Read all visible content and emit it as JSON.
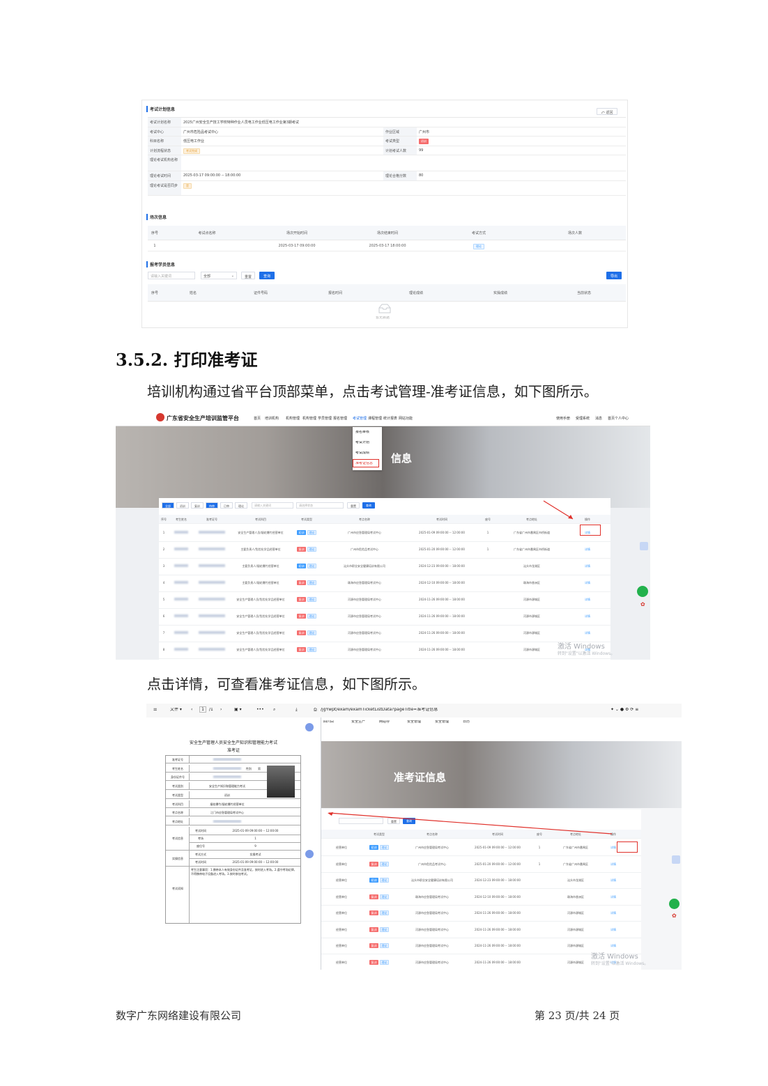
{
  "screenshot1": {
    "plan_section": "考试计划信息",
    "back_button": "返回",
    "plan_rows": [
      {
        "k": "考试计划名称",
        "v": "2025广州安全生产技工学校特种作业人员电工作业低压电工作业第3期考试"
      },
      {
        "k": "考试中心",
        "v": "广州市危险品考试中心",
        "k2": "作业区域",
        "v2": "广州市"
      },
      {
        "k": "科目名称",
        "v": "低压电工作业",
        "k2": "考试类型",
        "v2": "初训"
      },
      {
        "k": "计划流程状态",
        "v": "考试完成",
        "k2": "计划考试人数",
        "v2": "99"
      },
      {
        "k": "理论考试机构名称",
        "v": ""
      },
      {
        "k": "理论考试时间",
        "v": "2025-03-17 09:00:00 -- 18:00:00",
        "k2": "理论合格分数",
        "v2": "80"
      },
      {
        "k": "理论考试是否同步",
        "v": "是"
      }
    ],
    "session_section": "场次信息",
    "session_headers": [
      "序号",
      "考试点名称",
      "场次开始时间",
      "场次结束时间",
      "考试方式",
      "场次人数"
    ],
    "session_rows": [
      [
        "1",
        "",
        "2025-03-17 09:00:00",
        "2025-03-17 18:00:00",
        "理论",
        ""
      ]
    ],
    "student_section": "报考学员信息",
    "search_placeholder": "请输入关键词",
    "select_value": "全部",
    "reset_label": "重置",
    "query_label": "查询",
    "export_label": "导出",
    "student_headers": [
      "序号",
      "姓名",
      "证件号码",
      "报名时间",
      "理论成绩",
      "实操成绩",
      "当前状态"
    ],
    "empty_text": "暂无数据"
  },
  "section_heading": {
    "number": "3.5.2.",
    "title": "打印准考证"
  },
  "para1": "培训机构通过省平台顶部菜单，点击考试管理-准考证信息，如下图所示。",
  "screenshot2": {
    "site_title": "广东省安全生产培训监管平台",
    "nav_items": [
      "首页",
      "培训机构",
      "机构管理",
      "机构管理",
      "学员管理",
      "报名管理",
      "考试管理",
      "课程管理",
      "统计报表",
      "网站功能"
    ],
    "user_items": [
      "使用手册",
      "受理系统",
      "消息",
      "首页个人中心"
    ],
    "dropdown_items": [
      "报名审核",
      "考试计划",
      "考试成绩",
      "准考证信息"
    ],
    "banner_title": "信息",
    "filter_buttons": [
      "全部",
      "初训",
      "复训",
      "待审",
      "已审",
      "理论"
    ],
    "filter_placeholder1": "请输入关键词",
    "filter_placeholder2": "请选择状态",
    "reset_label": "重置",
    "query_label": "查询",
    "table_headers": [
      "序号",
      "考生姓名",
      "准考证号",
      "考试科目",
      "考试类型",
      "考点名称",
      "考试时间",
      "座号",
      "考点地址",
      "操作"
    ],
    "rows": [
      {
        "n": "1",
        "subject": "安全生产管理人员/烟花爆竹经营单位",
        "t1": "初训",
        "t2": "理论",
        "site": "广州市应急管理局考试中心",
        "time": "2025-01-09 09:00:00 -- 12:00:00",
        "seat": "1",
        "addr": "广东省广州市番禺区市桥街道",
        "op": "详情"
      },
      {
        "n": "2",
        "subject": "主要负责人/危险化学品经营单位",
        "t1": "复训",
        "t2": "理论",
        "site": "广州市危险品考试中心",
        "time": "2025-01-20 09:00:00 -- 12:00:00",
        "seat": "1",
        "addr": "广东省广州市番禺区市桥街道",
        "op": "详情"
      },
      {
        "n": "3",
        "subject": "主要负责人/烟花爆竹经营单位",
        "t1": "初训",
        "t2": "理论",
        "site": "汕头市职业安全健康培训有限公司",
        "time": "2024-12-23 09:00:00 -- 18:00:00",
        "seat": "",
        "addr": "汕头市龙湖区",
        "op": "详情"
      },
      {
        "n": "4",
        "subject": "主要负责人/烟花爆竹经营单位",
        "t1": "复训",
        "t2": "理论",
        "site": "珠海市应急管理局考试中心",
        "time": "2024-12-10 09:00:00 -- 18:00:00",
        "seat": "",
        "addr": "珠海市香洲区",
        "op": "详情"
      },
      {
        "n": "5",
        "subject": "安全生产管理人员/危险化学品经营单位",
        "t1": "复训",
        "t2": "理论",
        "site": "河源市应急管理局考试中心",
        "time": "2024-11-26 09:00:00 -- 18:00:00",
        "seat": "",
        "addr": "河源市源城区",
        "op": "详情"
      },
      {
        "n": "6",
        "subject": "安全生产管理人员/危险化学品经营单位",
        "t1": "复训",
        "t2": "理论",
        "site": "河源市应急管理局考试中心",
        "time": "2024-11-26 09:00:00 -- 18:00:00",
        "seat": "",
        "addr": "河源市源城区",
        "op": "详情"
      },
      {
        "n": "7",
        "subject": "安全生产管理人员/危险化学品经营单位",
        "t1": "复训",
        "t2": "理论",
        "site": "河源市应急管理局考试中心",
        "time": "2024-11-26 09:00:00 -- 18:00:00",
        "seat": "",
        "addr": "河源市源城区",
        "op": "详情"
      },
      {
        "n": "8",
        "subject": "安全生产管理人员/危险化学品经营单位",
        "t1": "复训",
        "t2": "理论",
        "site": "河源市应急管理局考试中心",
        "time": "2024-11-26 09:00:00 -- 18:00:00",
        "seat": "",
        "addr": "河源市源城区",
        "op": "详情"
      }
    ],
    "watermark": "激活 Windows",
    "watermark_sub": "转到\"设置\"以激活 Windows。"
  },
  "para2": "点击详情，可查看准考证信息，如下图所示。",
  "screenshot3": {
    "pdf_file_label": "文件",
    "pdf_page": "1",
    "pdf_page_total": "/1",
    "pdf_url": "/jgYwpt/exam/examTicketListData?pageTitle=准考证信息",
    "bookmarks": [
      "四川白",
      "安全生产",
      "网站导",
      "安全管理",
      "安全管理",
      "日历"
    ],
    "ticket_title": "安全生产管理人员安全生产知识和管理能力考试",
    "ticket_subtitle": "准考证",
    "ticket_rows": [
      {
        "k": "准考证号",
        "v": ""
      },
      {
        "k": "考生姓名",
        "v": "",
        "extra": "性别",
        "extra2": "男"
      },
      {
        "k": "身份证件号",
        "v": ""
      },
      {
        "k": "考试类别",
        "v": "安全生产知识和管理能力考试"
      },
      {
        "k": "考试类型",
        "v": "初训"
      },
      {
        "k": "考试科目",
        "v": "烟花爆竹/烟花爆竹经营单位"
      },
      {
        "k": "考点名称",
        "v": "江门市应急管理局考试中心"
      },
      {
        "k": "考点地址",
        "v": ""
      }
    ],
    "theory_label": "考试信息",
    "theory_rows": [
      {
        "k": "考试时间",
        "v": "2025-01-09 09:00:00 -- 12:00:00"
      },
      {
        "k": "考场",
        "v": "1"
      },
      {
        "k": "座位号",
        "v": "9"
      }
    ],
    "practice_label": "实操信息",
    "practice_rows": [
      {
        "k": "考试方式",
        "v": "实操考试"
      },
      {
        "k": "考试时间",
        "v": "2025-01-09 09:00:00 -- 12:00:00"
      }
    ],
    "notice_label": "考试须知",
    "notice_text": "考生注意事项：1.携带本人有效身份证件及准考证，按时进入考场。2.遵守考场纪律，不得携带电子设备进入考场。3.按时参加考试。",
    "banner_title": "准考证信息",
    "reset_label": "重置",
    "query_label": "查询",
    "table_headers": [
      "考试类型",
      "考点名称",
      "考试时间",
      "座号",
      "考点地址",
      "操作"
    ],
    "rows": [
      {
        "c": "经营单位",
        "t1": "初训",
        "t2": "理论",
        "site": "广州市应急管理局考试中心",
        "time": "2025-01-09 09:00:00 -- 12:00:00",
        "seat": "1",
        "addr": "广东省广州市番禺区",
        "op": "详情"
      },
      {
        "c": "经营单位",
        "t1": "复训",
        "t2": "理论",
        "site": "广州市危险品考试中心",
        "time": "2025-01-20 09:00:00 -- 12:00:00",
        "seat": "1",
        "addr": "广东省广州市番禺区",
        "op": "详情"
      },
      {
        "c": "经营单位",
        "t1": "初训",
        "t2": "理论",
        "site": "汕头市职业安全健康培训有限公司",
        "time": "2024-12-23 09:00:00 -- 18:00:00",
        "seat": "",
        "addr": "汕头市龙湖区",
        "op": "详情"
      },
      {
        "c": "经营单位",
        "t1": "复训",
        "t2": "理论",
        "site": "珠海市应急管理局考试中心",
        "time": "2024-12-10 09:00:00 -- 18:00:00",
        "seat": "",
        "addr": "珠海市香洲区",
        "op": "详情"
      },
      {
        "c": "经营单位",
        "t1": "复训",
        "t2": "理论",
        "site": "河源市应急管理局考试中心",
        "time": "2024-11-26 09:00:00 -- 18:00:00",
        "seat": "",
        "addr": "河源市源城区",
        "op": "详情"
      },
      {
        "c": "经营单位",
        "t1": "复训",
        "t2": "理论",
        "site": "河源市应急管理局考试中心",
        "time": "2024-11-26 09:00:00 -- 18:00:00",
        "seat": "",
        "addr": "河源市源城区",
        "op": "详情"
      },
      {
        "c": "经营单位",
        "t1": "复训",
        "t2": "理论",
        "site": "河源市应急管理局考试中心",
        "time": "2024-11-26 09:00:00 -- 18:00:00",
        "seat": "",
        "addr": "河源市源城区",
        "op": "详情"
      },
      {
        "c": "经营单位",
        "t1": "复训",
        "t2": "理论",
        "site": "河源市应急管理局考试中心",
        "time": "2024-11-26 09:00:00 -- 18:00:00",
        "seat": "",
        "addr": "河源市源城区",
        "op": "详情"
      }
    ],
    "watermark": "激活 Windows",
    "watermark_sub": "转到\"设置\"以激活 Windows。"
  },
  "footer": {
    "company": "数字广东网络建设有限公司",
    "page": "第 23 页/共 24 页"
  },
  "colors": {
    "accent": "#1e6fe8",
    "red_highlight": "#e0302a",
    "tag_red": "#f56c6c"
  }
}
